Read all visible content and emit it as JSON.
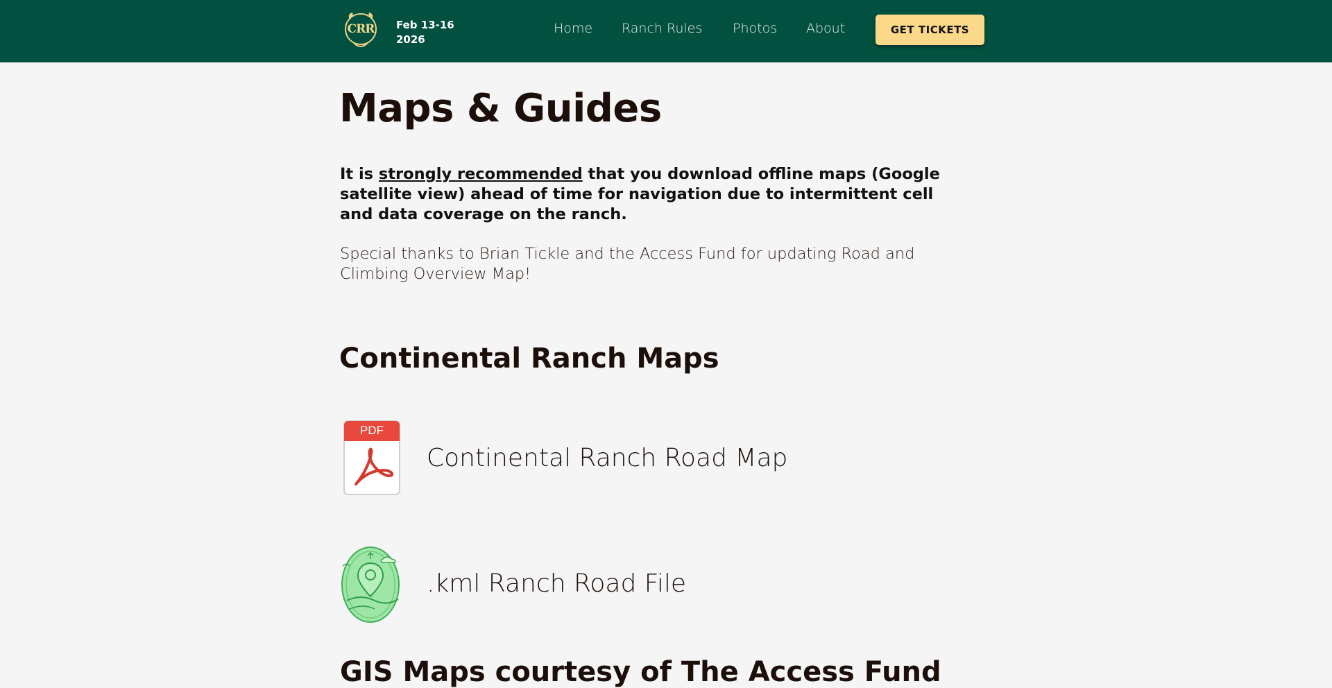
{
  "header": {
    "logo_text": "CRR",
    "event_date_line1": "Feb 13-16",
    "event_date_line2": "2026",
    "nav": [
      {
        "label": "Home"
      },
      {
        "label": "Ranch Rules"
      },
      {
        "label": "Photos"
      },
      {
        "label": "About"
      }
    ],
    "tickets_label": "GET TICKETS",
    "colors": {
      "bar": "#02503f",
      "button": "#fcd98a"
    }
  },
  "main": {
    "title": "Maps & Guides",
    "intro_prefix": "It is ",
    "intro_emphasis": "strongly recommended",
    "intro_suffix": " that you download offline maps (Google satellite view) ahead of time for navigation due to intermittent cell and data coverage on the ranch.",
    "thanks": "Special thanks to Brian Tickle and the Access Fund for updating Road and Climbing Overview Map!",
    "section_title": "Continental Ranch Maps",
    "files": [
      {
        "icon": "pdf-icon",
        "badge": "PDF",
        "label": "Continental Ranch Road Map"
      },
      {
        "icon": "map-pin-badge-icon",
        "label": ".kml Ranch Road File"
      }
    ],
    "next_section_title": "GIS Maps courtesy of The Access Fund"
  }
}
